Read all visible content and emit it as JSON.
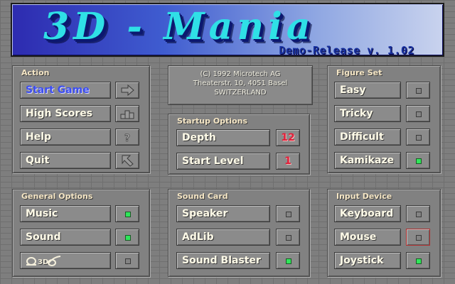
{
  "title": "3D - Mania",
  "subtitle": "Demo-Release v. 1.02",
  "info": {
    "line1": "(C) 1992 Microtech AG",
    "line2": "Theaterstr. 10, 4051 Basel",
    "line3": "SWITZERLAND"
  },
  "action": {
    "title": "Action",
    "items": [
      {
        "label": "Start Game",
        "icon": "arrow-right-icon"
      },
      {
        "label": "High Scores",
        "icon": "podium-icon"
      },
      {
        "label": "Help",
        "icon": "question-icon"
      },
      {
        "label": "Quit",
        "icon": "arrow-up-left-icon"
      }
    ]
  },
  "startup": {
    "title": "Startup Options",
    "items": [
      {
        "label": "Depth",
        "value": "12"
      },
      {
        "label": "Start Level",
        "value": "1"
      }
    ]
  },
  "figure_set": {
    "title": "Figure Set",
    "items": [
      {
        "label": "Easy",
        "on": false
      },
      {
        "label": "Tricky",
        "on": false
      },
      {
        "label": "Difficult",
        "on": false
      },
      {
        "label": "Kamikaze",
        "on": true
      }
    ]
  },
  "general": {
    "title": "General Options",
    "items": [
      {
        "label": "Music",
        "on": true
      },
      {
        "label": "Sound",
        "on": true
      },
      {
        "label": "",
        "icon": "stereo-glasses-icon",
        "on": false
      }
    ]
  },
  "sound_card": {
    "title": "Sound Card",
    "items": [
      {
        "label": "Speaker",
        "on": false
      },
      {
        "label": "AdLib",
        "on": false
      },
      {
        "label": "Sound Blaster",
        "on": true
      }
    ]
  },
  "input_device": {
    "title": "Input Device",
    "items": [
      {
        "label": "Keyboard",
        "on": false
      },
      {
        "label": "Mouse",
        "on": false
      },
      {
        "label": "Joystick",
        "on": true
      }
    ]
  },
  "colors": {
    "led_on": "#2fe65a",
    "selected_text": "#3c4ef0",
    "number_text": "#e0213b",
    "title_text": "#2fe0e6"
  }
}
